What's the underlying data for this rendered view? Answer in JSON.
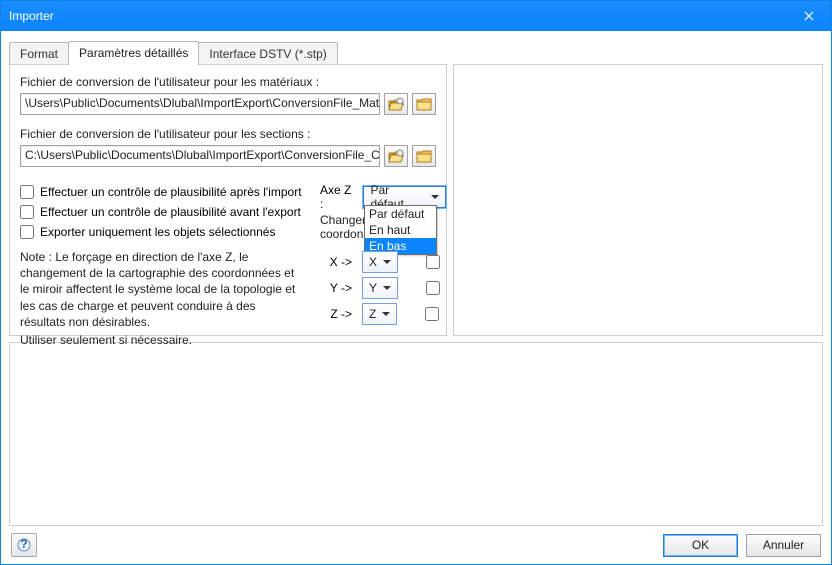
{
  "window": {
    "title": "Importer"
  },
  "tabs": {
    "format": "Format",
    "detailed": "Paramètres détaillés",
    "dstv": "Interface DSTV (*.stp)"
  },
  "materials": {
    "label": "Fichier de conversion de l'utilisateur pour les matériaux :",
    "path": "\\Users\\Public\\Documents\\Dlubal\\ImportExport\\ConversionFile_Material.txt"
  },
  "sections": {
    "label": "Fichier de conversion de l'utilisateur pour les sections :",
    "path": "C:\\Users\\Public\\Documents\\Dlubal\\ImportExport\\ConversionFile_CrossSect"
  },
  "checks": {
    "afterImport": "Effectuer un contrôle de plausibilité après l'import",
    "beforeExport": "Effectuer un contrôle de plausibilité avant l'export",
    "onlySelected": "Exporter uniquement les objets sélectionnés"
  },
  "note": {
    "l1": "Note : Le forçage en direction de l'axe Z, le changement de la cartographie des coordonnées et le miroir affectent le système local de la topologie et les cas de charge et peuvent conduire à des résultats non désirables.",
    "l2": "Utiliser seulement si nécessaire."
  },
  "axeZ": {
    "label": "Axe Z :",
    "selected": "Par défaut",
    "options": [
      "Par défaut",
      "En haut",
      "En bas"
    ],
    "highlighted": "En bas"
  },
  "changer": "Changer les\ncoordonnée",
  "coords": {
    "x": {
      "label": "X ->",
      "value": "X"
    },
    "y": {
      "label": "Y ->",
      "value": "Y"
    },
    "z": {
      "label": "Z ->",
      "value": "Z"
    }
  },
  "buttons": {
    "ok": "OK",
    "cancel": "Annuler"
  }
}
